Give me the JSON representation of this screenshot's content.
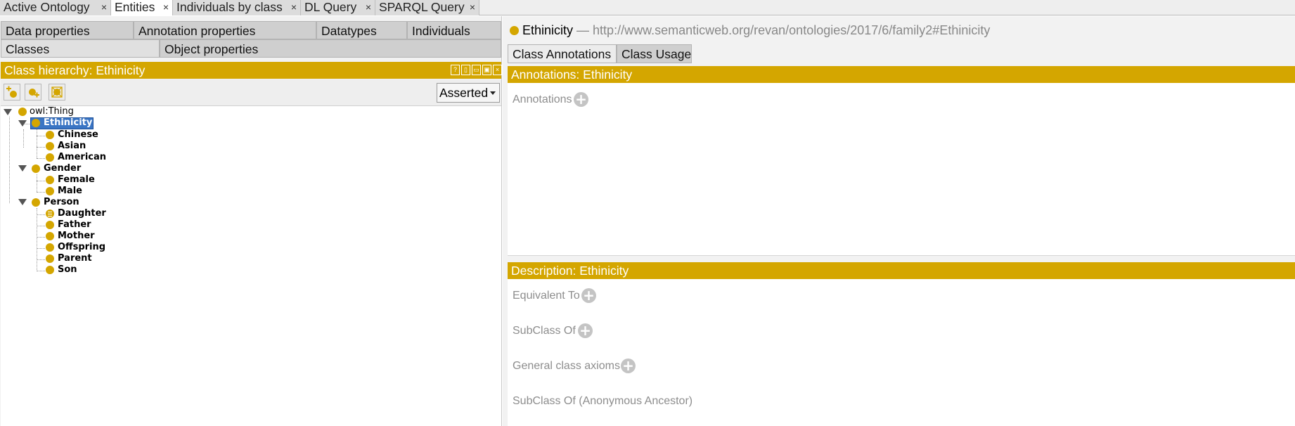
{
  "top_tabs": [
    {
      "label": "Active Ontology",
      "active": false
    },
    {
      "label": "Entities",
      "active": true
    },
    {
      "label": "Individuals by class",
      "active": false
    },
    {
      "label": "DL Query",
      "active": false
    },
    {
      "label": "SPARQL Query",
      "active": false
    }
  ],
  "close_glyph": "×",
  "left_tabs_row1": [
    "Data properties",
    "Annotation properties",
    "Datatypes",
    "Individuals"
  ],
  "left_tabs_row2": [
    "Classes",
    "Object properties"
  ],
  "hierarchy": {
    "title": "Class hierarchy: Ethinicity",
    "mode_select": "Asserted",
    "window_buttons": [
      "?",
      "▯",
      "▭",
      "▣",
      "×"
    ]
  },
  "tree": {
    "root": "owl:Thing",
    "items": [
      {
        "label": "Ethinicity",
        "level": 1,
        "selected": true,
        "icon": "class-dot-icon"
      },
      {
        "label": "Chinese",
        "level": 2,
        "icon": "class-dot-icon"
      },
      {
        "label": "Asian",
        "level": 2,
        "icon": "class-dot-icon"
      },
      {
        "label": "American",
        "level": 2,
        "icon": "class-dot-icon"
      },
      {
        "label": "Gender",
        "level": 1,
        "icon": "class-dot-icon"
      },
      {
        "label": "Female",
        "level": 2,
        "icon": "class-dot-icon"
      },
      {
        "label": "Male",
        "level": 2,
        "icon": "class-dot-icon"
      },
      {
        "label": "Person",
        "level": 1,
        "icon": "class-dot-icon"
      },
      {
        "label": "Daughter",
        "level": 2,
        "icon": "defined-class-icon"
      },
      {
        "label": "Father",
        "level": 2,
        "icon": "class-dot-icon"
      },
      {
        "label": "Mother",
        "level": 2,
        "icon": "class-dot-icon"
      },
      {
        "label": "Offspring",
        "level": 2,
        "icon": "class-dot-icon"
      },
      {
        "label": "Parent",
        "level": 2,
        "icon": "class-dot-icon"
      },
      {
        "label": "Son",
        "level": 2,
        "icon": "class-dot-icon"
      }
    ]
  },
  "entity": {
    "name": "Ethinicity",
    "iri": "— http://www.semanticweb.org/revan/ontologies/2017/6/family2#Ethinicity"
  },
  "right_tabs": [
    "Class Annotations",
    "Class Usage"
  ],
  "annotations": {
    "header": "Annotations: Ethinicity",
    "label": "Annotations"
  },
  "description": {
    "header": "Description: Ethinicity",
    "sections": [
      "Equivalent To",
      "SubClass Of",
      "General class axioms",
      "SubClass Of (Anonymous Ancestor)"
    ]
  },
  "colors": {
    "accent": "#d4a600",
    "selection": "#3a75c4"
  }
}
